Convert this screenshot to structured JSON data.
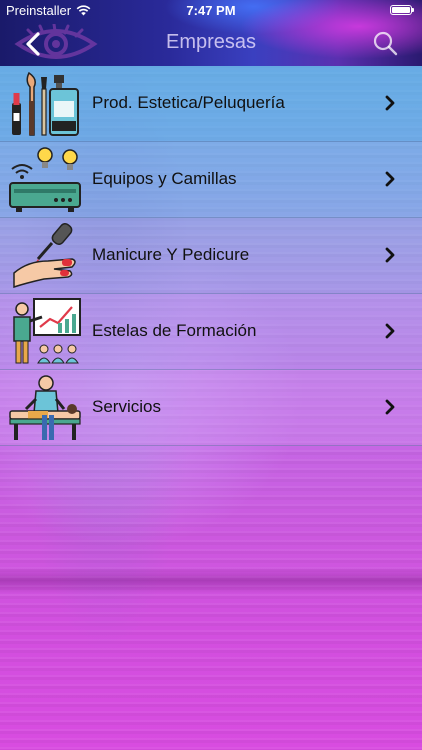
{
  "status": {
    "carrier": "Preinstaller",
    "time": "7:47 PM"
  },
  "nav": {
    "title": "Empresas"
  },
  "colors": {
    "header_dark": "#1a1a6a",
    "accent_magenta": "#d84ce0",
    "row_blue": "#5aaae6"
  },
  "categories": [
    {
      "label": "Prod. Estetica/Peluquería",
      "icon": "cosmetics-icon"
    },
    {
      "label": "Equipos y Camillas",
      "icon": "equipment-icon"
    },
    {
      "label": "Manicure Y Pedicure",
      "icon": "manicure-icon"
    },
    {
      "label": "Estelas de Formación",
      "icon": "training-icon"
    },
    {
      "label": "Servicios",
      "icon": "massage-icon"
    }
  ]
}
